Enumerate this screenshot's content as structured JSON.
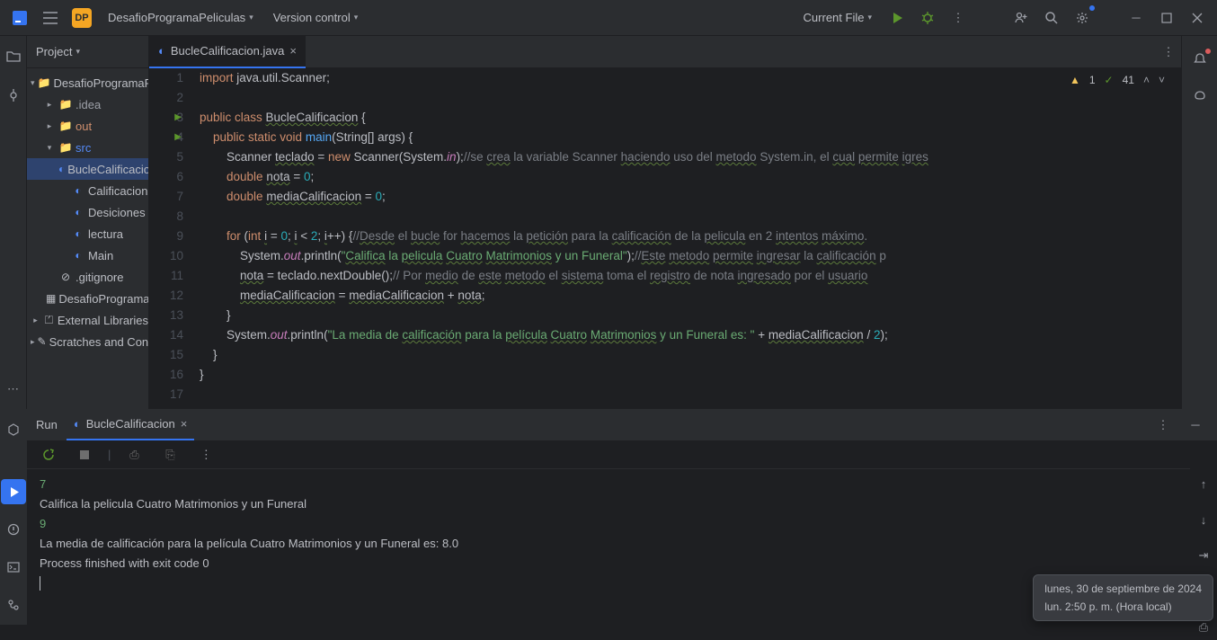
{
  "titlebar": {
    "project_badge": "DP",
    "project_name": "DesafioProgramaPeliculas",
    "version_control": "Version control",
    "run_config": "Current File"
  },
  "project": {
    "header": "Project",
    "tree": [
      {
        "arrow": "▾",
        "icon": "folder",
        "label": "DesafioProgramaPeliculas",
        "indent": 0,
        "color": "#bcbec4"
      },
      {
        "arrow": "▸",
        "icon": "folder",
        "label": ".idea",
        "indent": 1,
        "color": "#9da0a8"
      },
      {
        "arrow": "▸",
        "icon": "folder-out",
        "label": "out",
        "indent": 1,
        "color": "#cf8e6d"
      },
      {
        "arrow": "▾",
        "icon": "folder-src",
        "label": "src",
        "indent": 1,
        "color": "#548af7"
      },
      {
        "arrow": "",
        "icon": "class",
        "label": "BucleCalificacion",
        "indent": 2,
        "sel": true
      },
      {
        "arrow": "",
        "icon": "class",
        "label": "Calificacion",
        "indent": 2
      },
      {
        "arrow": "",
        "icon": "class",
        "label": "Desiciones",
        "indent": 2
      },
      {
        "arrow": "",
        "icon": "class",
        "label": "lectura",
        "indent": 2
      },
      {
        "arrow": "",
        "icon": "class",
        "label": "Main",
        "indent": 2
      },
      {
        "arrow": "",
        "icon": "ignore",
        "label": ".gitignore",
        "indent": 1
      },
      {
        "arrow": "",
        "icon": "iml",
        "label": "DesafioProgramaPeliculas.iml",
        "indent": 1
      },
      {
        "arrow": "▸",
        "icon": "lib",
        "label": "External Libraries",
        "indent": 0
      },
      {
        "arrow": "▸",
        "icon": "scratch",
        "label": "Scratches and Consoles",
        "indent": 0
      }
    ]
  },
  "editor": {
    "tab_file": "BucleCalificacion.java",
    "warnings": "1",
    "checks": "41"
  },
  "run": {
    "title": "Run",
    "tab": "BucleCalificacion",
    "output": [
      {
        "t": "7",
        "c": "#6aab73"
      },
      {
        "t": "Califica la pelicula Cuatro Matrimonios y un Funeral",
        "c": "#bcbec4"
      },
      {
        "t": "9",
        "c": "#6aab73"
      },
      {
        "t": "La media de calificación para la película Cuatro Matrimonios y un Funeral es: 8.0",
        "c": "#bcbec4"
      },
      {
        "t": "",
        "c": "#bcbec4"
      },
      {
        "t": "Process finished with exit code 0",
        "c": "#bcbec4"
      }
    ]
  },
  "tooltip": {
    "line1": "lunes, 30 de septiembre de 2024",
    "line2": "lun. 2:50 p. m. (Hora local)"
  }
}
